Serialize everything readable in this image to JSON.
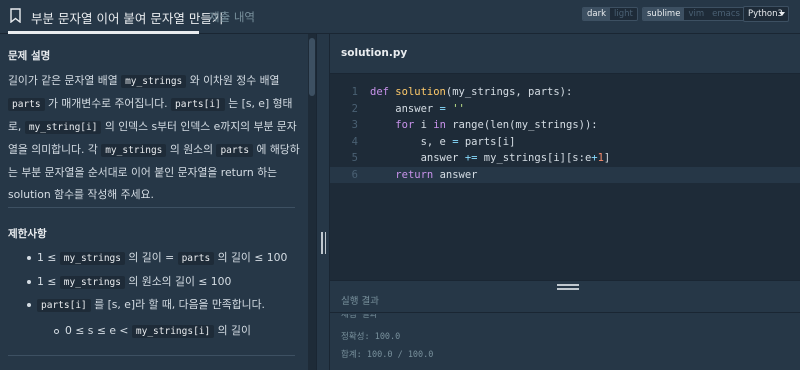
{
  "header": {
    "title": "부분 문자열 이어 붙여 문자열 만들기",
    "submissions_tab": "제출 내역",
    "theme_options": [
      "dark",
      "light"
    ],
    "theme_selected": "dark",
    "keymap_options": [
      "sublime",
      "vim",
      "emacs"
    ],
    "keymap_selected": "sublime",
    "language": "Python3"
  },
  "problem": {
    "description_title": "문제 설명",
    "description": [
      {
        "t": "text",
        "v": "길이가 같은 문자열 배열 "
      },
      {
        "t": "code",
        "v": "my_strings"
      },
      {
        "t": "text",
        "v": " 와 이차원 정수 배열 "
      },
      {
        "t": "code",
        "v": "parts"
      },
      {
        "t": "text",
        "v": " 가 매개변수로 주어집니다. "
      },
      {
        "t": "code",
        "v": "parts[i]"
      },
      {
        "t": "text",
        "v": " 는 [s, e] 형태로, "
      },
      {
        "t": "code",
        "v": "my_string[i]"
      },
      {
        "t": "text",
        "v": " 의 인덱스 s부터 인덱스 e까지의 부분 문자열을 의미합니다. 각 "
      },
      {
        "t": "code",
        "v": "my_strings"
      },
      {
        "t": "text",
        "v": " 의 원소의 "
      },
      {
        "t": "code",
        "v": "parts"
      },
      {
        "t": "text",
        "v": " 에 해당하는 부분 문자열을 순서대로 이어 붙인 문자열을 return 하는 solution 함수를 작성해 주세요."
      }
    ],
    "constraints_title": "제한사항",
    "constraints": [
      {
        "pre": "1 ≤ ",
        "code": "my_strings",
        "mid": " 의 길이 = ",
        "code2": "parts",
        "post": " 의 길이 ≤ 100"
      },
      {
        "pre": "1 ≤ ",
        "code": "my_strings",
        "mid": " 의 원소의 길이 ≤ 100",
        "code2": "",
        "post": ""
      },
      {
        "pre": "",
        "code": "parts[i]",
        "mid": " 를 [s, e]라 할 때, 다음을 만족합니다.",
        "code2": "",
        "post": ""
      }
    ],
    "sub_constraint": {
      "pre": "0 ≤ s ≤ e < ",
      "code": "my_strings[i]",
      "post": " 의 길이"
    }
  },
  "editor": {
    "filename": "solution.py",
    "line_numbers": [
      "1",
      "2",
      "3",
      "4",
      "5",
      "6"
    ],
    "code": [
      [
        {
          "c": "kw",
          "v": "def "
        },
        {
          "c": "fn",
          "v": "solution"
        },
        {
          "c": "",
          "v": "(my_strings, parts):"
        }
      ],
      [
        {
          "c": "",
          "v": "    answer "
        },
        {
          "c": "op",
          "v": "= "
        },
        {
          "c": "str",
          "v": "''"
        }
      ],
      [
        {
          "c": "",
          "v": "    "
        },
        {
          "c": "kw",
          "v": "for "
        },
        {
          "c": "",
          "v": "i "
        },
        {
          "c": "kw",
          "v": "in "
        },
        {
          "c": "",
          "v": "range(len(my_strings)):"
        }
      ],
      [
        {
          "c": "",
          "v": "        s, e "
        },
        {
          "c": "op",
          "v": "= "
        },
        {
          "c": "",
          "v": "parts[i]"
        }
      ],
      [
        {
          "c": "",
          "v": "        answer "
        },
        {
          "c": "op",
          "v": "+= "
        },
        {
          "c": "",
          "v": "my_strings[i][s:e"
        },
        {
          "c": "op",
          "v": "+"
        },
        {
          "c": "nm",
          "v": "1"
        },
        {
          "c": "",
          "v": "]"
        }
      ],
      [
        {
          "c": "",
          "v": "    "
        },
        {
          "c": "kw",
          "v": "return "
        },
        {
          "c": "",
          "v": "answer"
        }
      ]
    ]
  },
  "result": {
    "title": "실행 결과",
    "partial_line": "채점 결과",
    "accuracy": "정확성: 100.0",
    "total": "합계: 100.0 / 100.0"
  }
}
